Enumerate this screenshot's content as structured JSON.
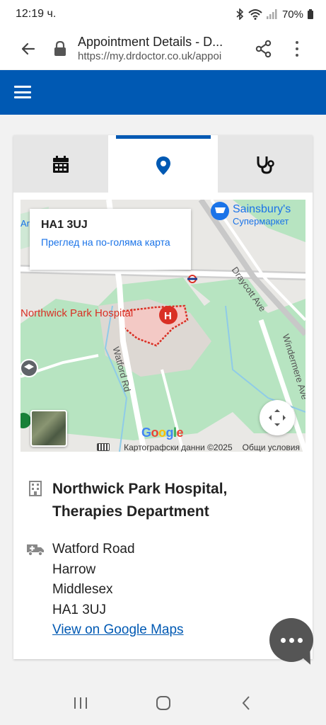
{
  "status_bar": {
    "time": "12:19 ч.",
    "battery": "70%",
    "icons": [
      "bluetooth-icon",
      "wifi-icon",
      "signal-icon",
      "battery-icon"
    ]
  },
  "browser": {
    "page_title": "Appointment Details - D...",
    "url": "https://my.drdoctor.co.uk/appoi"
  },
  "header": {
    "brand_color": "#0059b3"
  },
  "tabs": [
    {
      "icon": "calendar-icon",
      "active": false
    },
    {
      "icon": "location-pin-icon",
      "active": true
    },
    {
      "icon": "stethoscope-icon",
      "active": false
    }
  ],
  "map": {
    "info_title": "HA1 3UJ",
    "info_link": "Преглед на по-голяма карта",
    "labels": {
      "sainsburys": "Sainsbury's",
      "supermarket": "Супермаркет",
      "hospital": "Northwick Park Hospital",
      "draycott": "Draycott Ave",
      "watford": "Watford Rd",
      "windermere": "Windermere Ave",
      "ar_fragment": "Ar"
    },
    "google": "Google",
    "attribution": "Картографски данни ©2025",
    "terms": "Общи условия"
  },
  "location": {
    "name": "Northwick Park Hospital, Therapies Department",
    "address_lines": [
      "Watford Road",
      "Harrow",
      "Middlesex",
      "HA1 3UJ"
    ],
    "maps_link": "View on Google Maps"
  },
  "colors": {
    "accent": "#0059b3",
    "link": "#0059b3",
    "hospital_red": "#d93025",
    "park_green": "#b7e4c1"
  }
}
